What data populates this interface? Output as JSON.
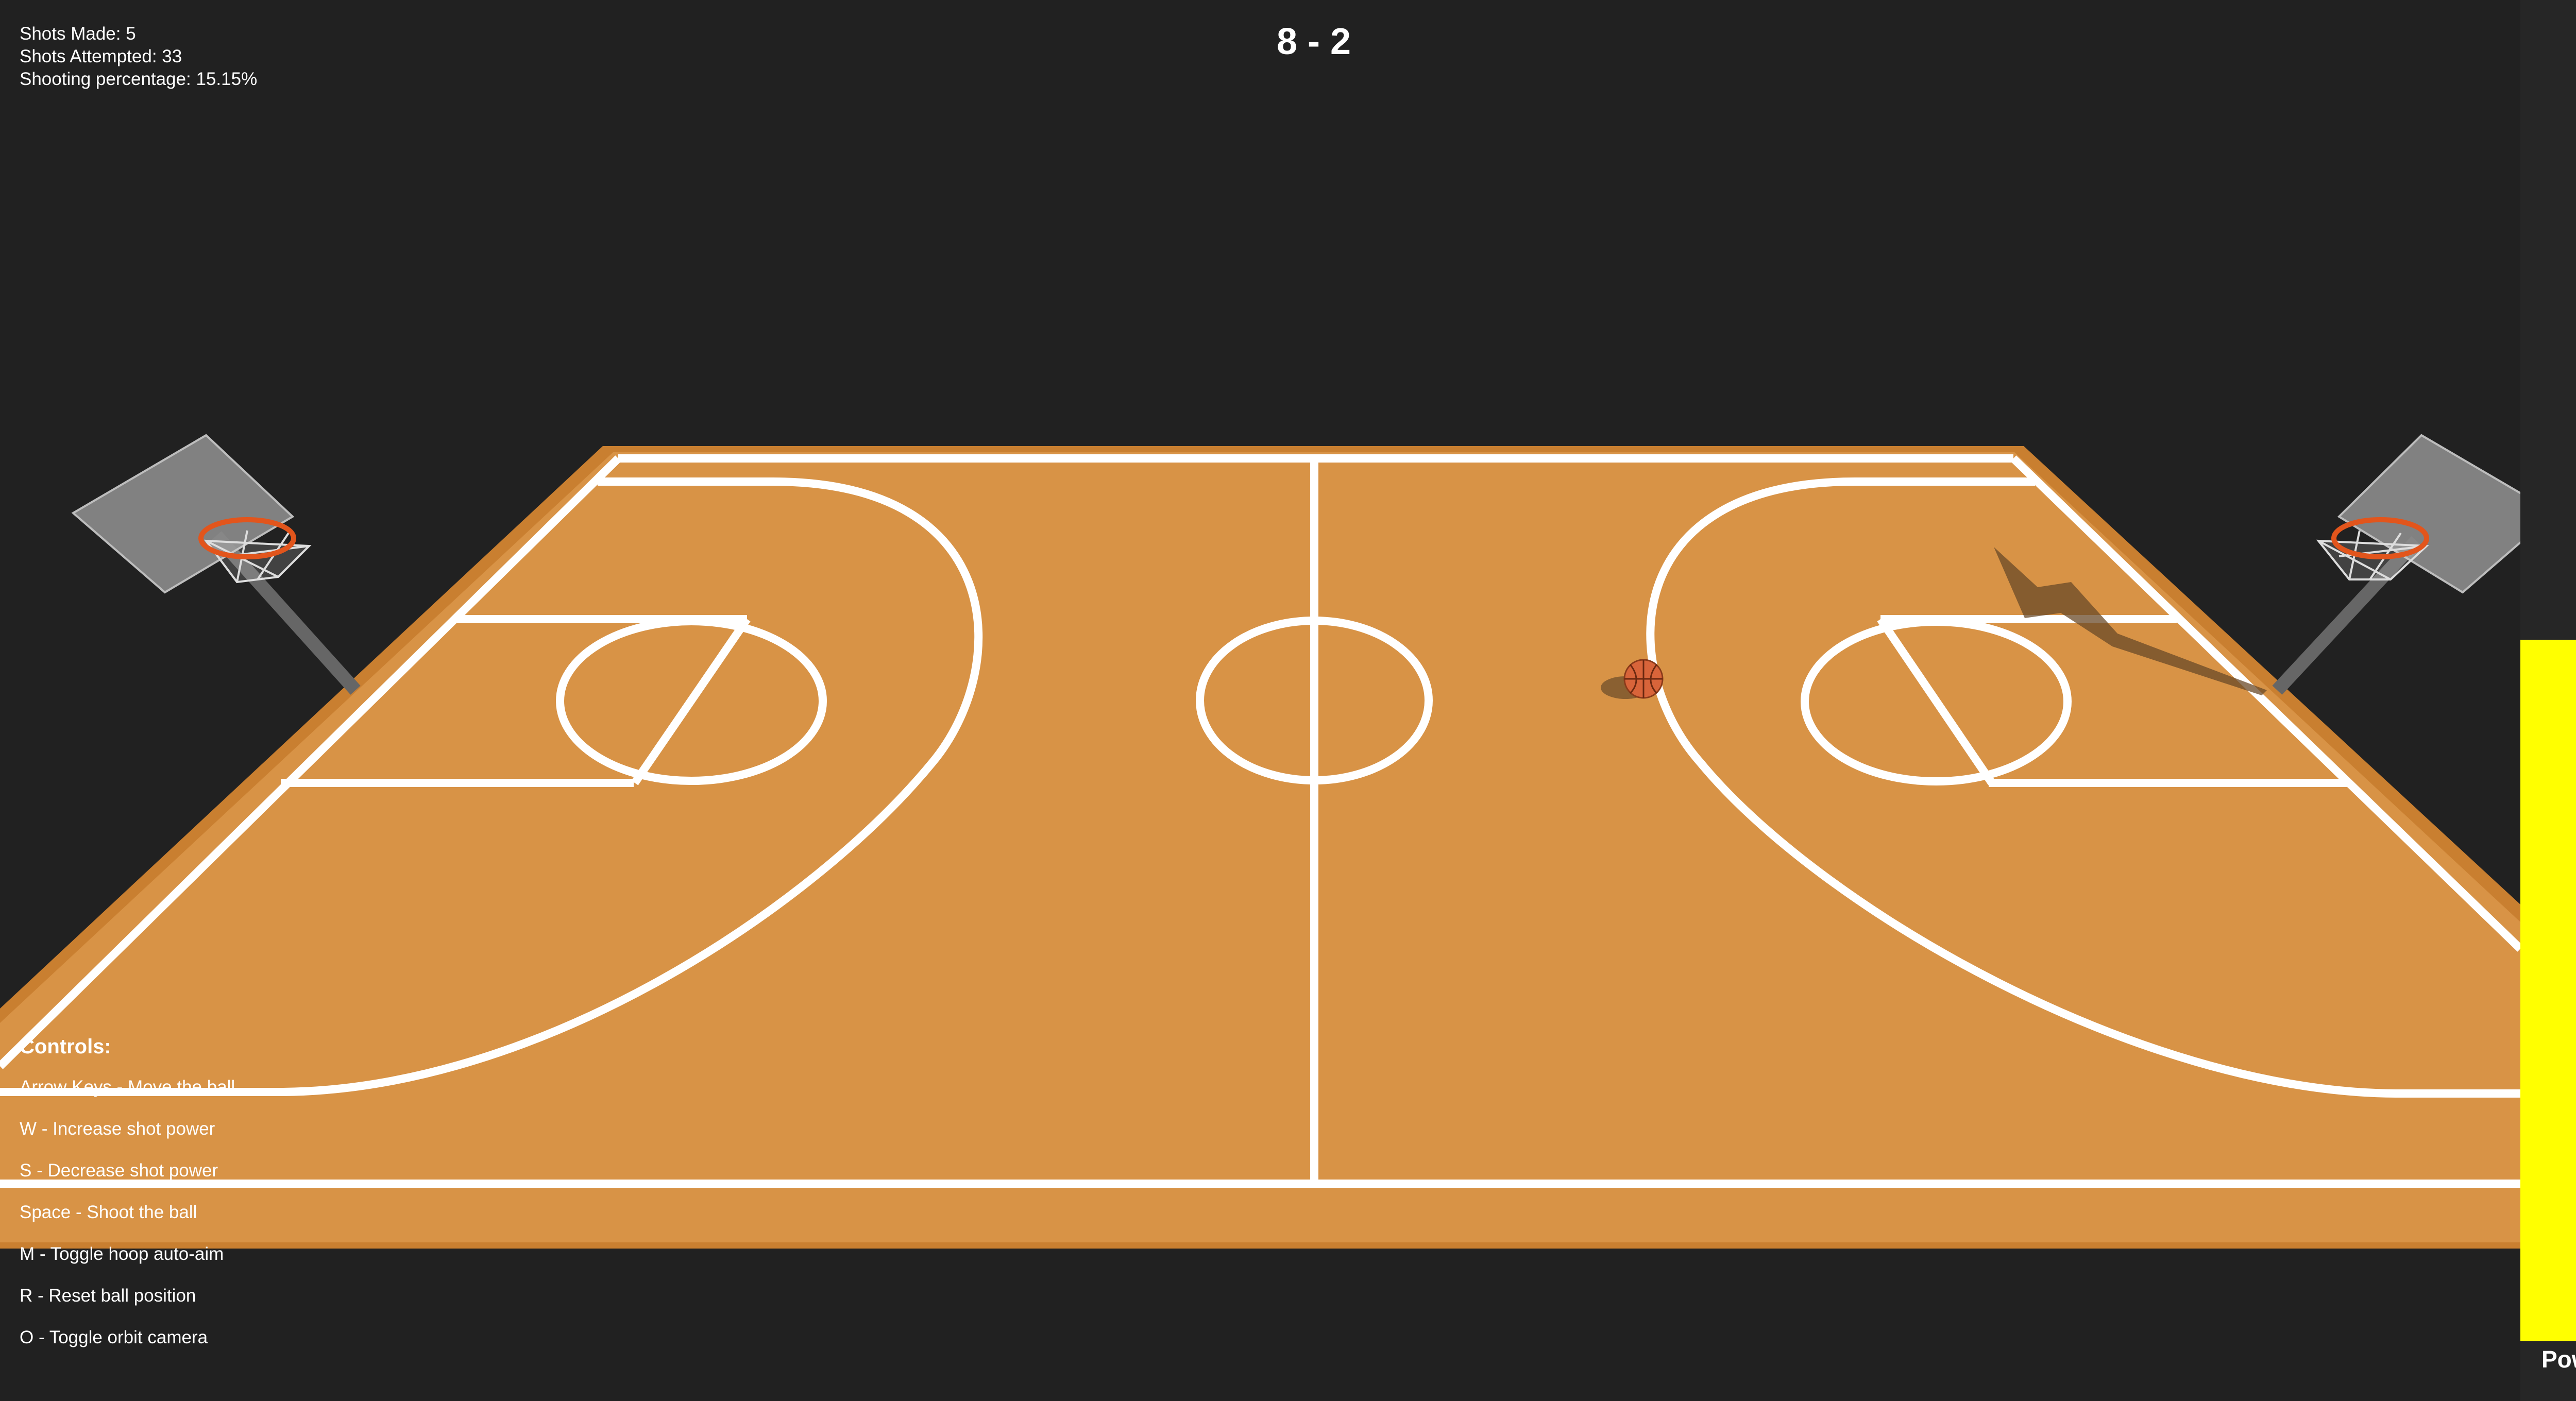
{
  "stats": {
    "shots_made": "Shots Made: 5",
    "shots_attempted": "Shots Attempted: 33",
    "shooting_percentage": "Shooting percentage: 15.15%"
  },
  "score": "8 - 2",
  "controls": {
    "title": "Controls:",
    "items": [
      "Arrow Keys - Move the ball",
      "W - Increase shot power",
      "S - Decrease shot power",
      "Space - Shoot the ball",
      "M - Toggle hoop auto-aim",
      "R - Reset ball position",
      "O - Toggle orbit camera"
    ]
  },
  "power": {
    "label": "Power",
    "level": 0.74
  },
  "colors": {
    "background": "#212121",
    "court": "#d89346",
    "court_edge": "#c97f30",
    "lines": "#ffffff",
    "rim": "#e2551c",
    "power_bar": "#ffff00",
    "ball": "#d8643a"
  },
  "icons": [
    "basketball-icon",
    "left-hoop-icon",
    "right-hoop-icon"
  ]
}
